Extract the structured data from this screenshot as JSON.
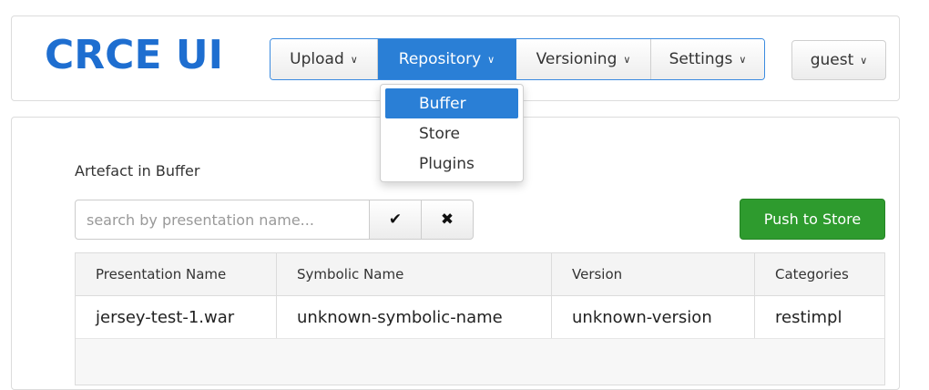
{
  "app": {
    "logo": "CRCE UI"
  },
  "nav": {
    "items": [
      {
        "label": "Upload",
        "active": false
      },
      {
        "label": "Repository",
        "active": true
      },
      {
        "label": "Versioning",
        "active": false
      },
      {
        "label": "Settings",
        "active": false
      }
    ],
    "user_label": "guest"
  },
  "repository_menu": {
    "items": [
      {
        "label": "Buffer",
        "selected": true
      },
      {
        "label": "Store",
        "selected": false
      },
      {
        "label": "Plugins",
        "selected": false
      }
    ]
  },
  "main": {
    "section_title": "Artefact in Buffer",
    "search": {
      "placeholder": "search by presentation name...",
      "value": ""
    },
    "search_confirm_icon": "check-icon",
    "search_clear_icon": "x-icon",
    "push_button_label": "Push to Store",
    "push_button_color": "#2e9b2e",
    "table": {
      "columns": [
        "Presentation Name",
        "Symbolic Name",
        "Version",
        "Categories"
      ],
      "rows": [
        [
          "jersey-test-1.war",
          "unknown-symbolic-name",
          "unknown-version",
          "restimpl"
        ]
      ]
    }
  },
  "colors": {
    "brand": "#1e6ed0",
    "accent": "#2a7fd6"
  }
}
